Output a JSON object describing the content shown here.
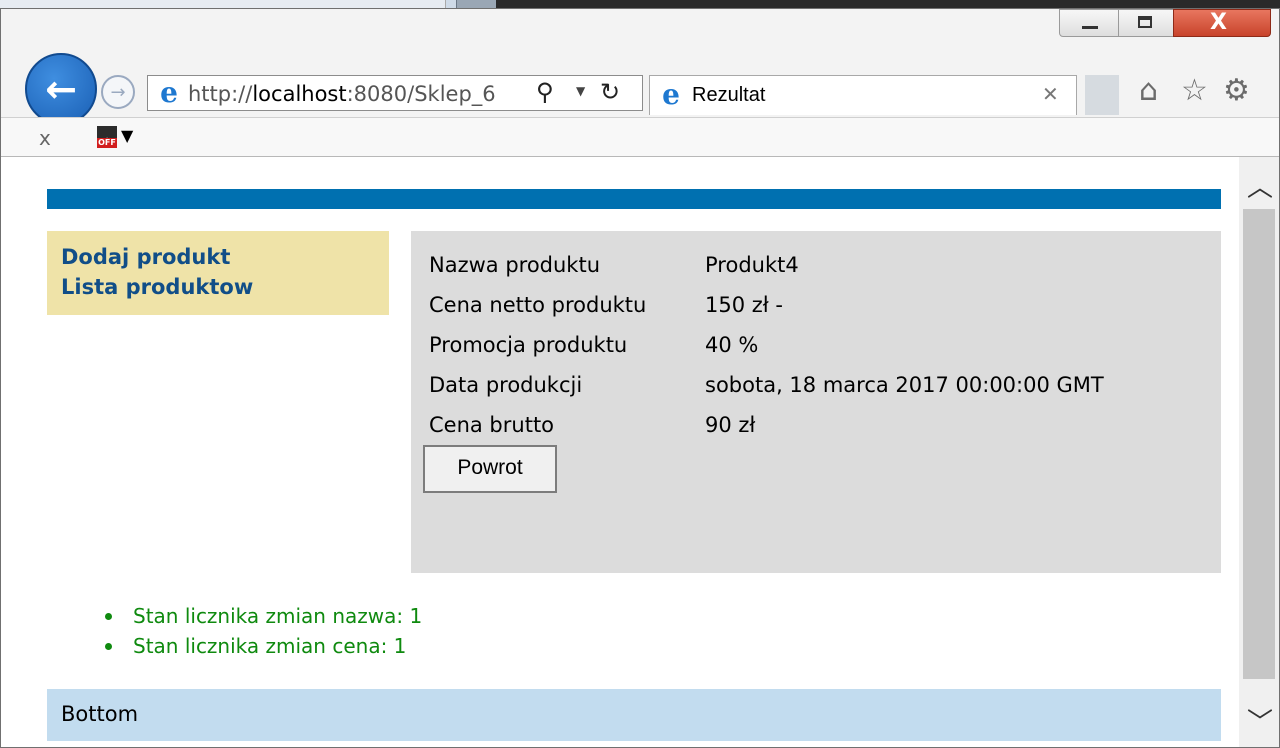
{
  "browser": {
    "url_prefix": "http://",
    "url_host": "localhost",
    "url_rest": ":8080/Sklep_6",
    "tab_title": "Rezultat",
    "window_buttons": {
      "minimize": "—",
      "maximize": "☐",
      "close": "X"
    }
  },
  "command_bar": {
    "close_label": "x"
  },
  "nav": {
    "links": [
      "Dodaj produkt",
      "Lista produktow"
    ]
  },
  "product": {
    "rows": [
      {
        "label": "Nazwa produktu",
        "value": "Produkt4"
      },
      {
        "label": "Cena netto produktu",
        "value": "150 zł -"
      },
      {
        "label": "Promocja produktu",
        "value": "40 %"
      },
      {
        "label": "Data produkcji",
        "value": "sobota, 18 marca 2017 00:00:00 GMT"
      },
      {
        "label": "Cena brutto",
        "value": "90 zł"
      }
    ],
    "back_button": "Powrot"
  },
  "counters": [
    "Stan licznika zmian nazwa: 1",
    "Stan licznika zmian cena: 1"
  ],
  "footer": {
    "label": "Bottom"
  },
  "colors": {
    "header_bar": "#0070b0",
    "nav_bg": "#efe3a8",
    "nav_link": "#114e88",
    "content_bg": "#dcdcdc",
    "counter_text": "#0f8a0f",
    "footer_bg": "#c2dcef"
  }
}
